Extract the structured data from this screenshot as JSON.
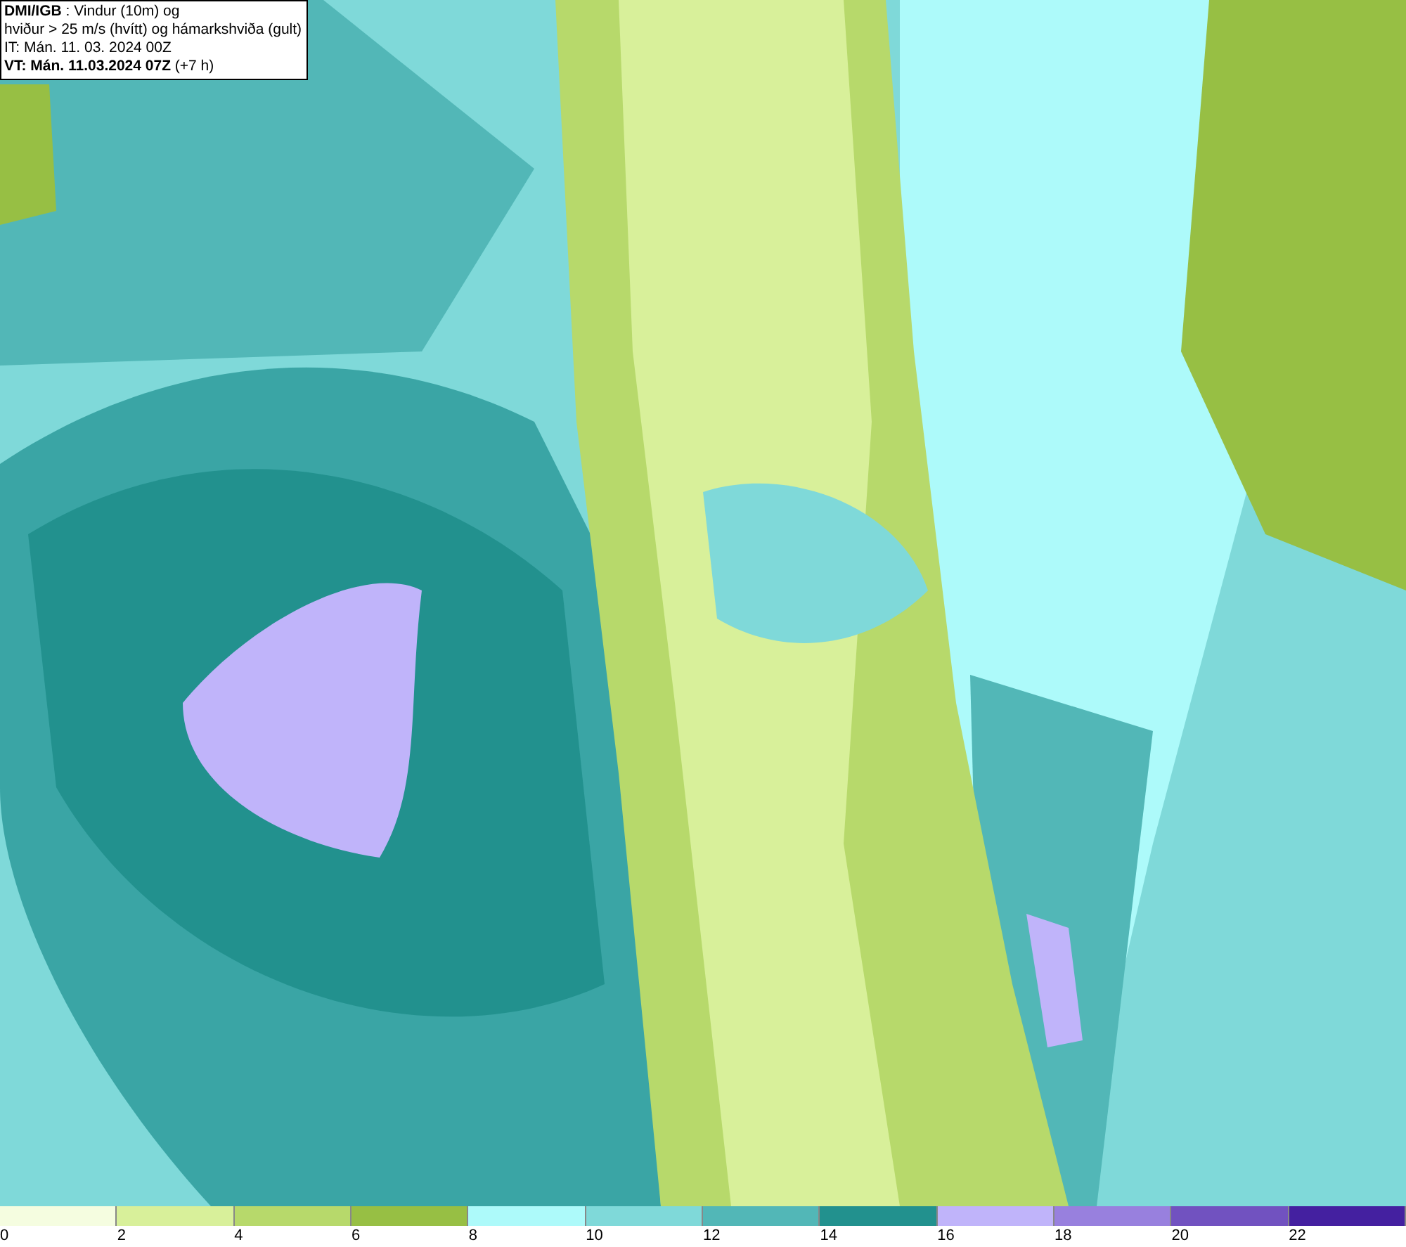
{
  "header": {
    "lines": [
      "**DMI/IGB** : Vindur (10m) og",
      "hviður > 25 m/s (hvítt) og hámarkshviða (gult)",
      "IT: Mán. 11. 03. 2024 00Z",
      "**VT: Mán. 11.03.2024 07Z** (+7 h)"
    ]
  },
  "legend": [
    {
      "label": "0",
      "color": "#f5fde0"
    },
    {
      "label": "2",
      "color": "#d8f09a"
    },
    {
      "label": "4",
      "color": "#b7d96b"
    },
    {
      "label": "6",
      "color": "#97bf44"
    },
    {
      "label": "8",
      "color": "#adfafa"
    },
    {
      "label": "10",
      "color": "#7fd9d9"
    },
    {
      "label": "12",
      "color": "#52b7b7"
    },
    {
      "label": "14",
      "color": "#22918e"
    },
    {
      "label": "16",
      "color": "#c0b4fa"
    },
    {
      "label": "18",
      "color": "#9880de"
    },
    {
      "label": "20",
      "color": "#7152c0"
    },
    {
      "label": "22",
      "color": "#4420a0"
    }
  ]
}
